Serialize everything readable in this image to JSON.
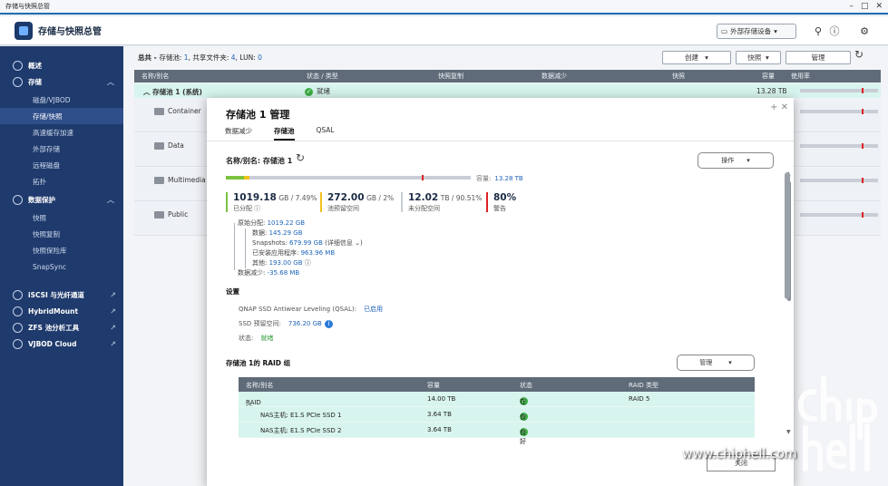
{
  "window": {
    "title": "存储与快照总管",
    "controls": [
      "–",
      "□",
      "✕"
    ]
  },
  "header": {
    "app_title": "存储与快照总管",
    "external_button": "外部存储设备"
  },
  "sidebar": {
    "items": [
      {
        "label": "概述",
        "level": "top"
      },
      {
        "label": "存储",
        "level": "top"
      },
      {
        "label": "磁盘/VJBOD",
        "level": "sub"
      },
      {
        "label": "存储/快照",
        "level": "sub",
        "active": true
      },
      {
        "label": "高速缓存加速",
        "level": "sub"
      },
      {
        "label": "外部存储",
        "level": "sub"
      },
      {
        "label": "远程磁盘",
        "level": "sub"
      },
      {
        "label": "拓扑",
        "level": "sub"
      },
      {
        "label": "数据保护",
        "level": "top"
      },
      {
        "label": "快照",
        "level": "sub"
      },
      {
        "label": "快照复制",
        "level": "sub"
      },
      {
        "label": "快照保险库",
        "level": "sub"
      },
      {
        "label": "SnapSync",
        "level": "sub"
      },
      {
        "label": "iSCSI 与光纤通道",
        "level": "top"
      },
      {
        "label": "HybridMount",
        "level": "top"
      },
      {
        "label": "ZFS 池分析工具",
        "level": "top"
      },
      {
        "label": "VJBOD Cloud",
        "level": "top"
      }
    ]
  },
  "main": {
    "summary_prefix": "总共 - ",
    "summary_pool_label": "存储池: ",
    "summary_pool_val": "1",
    "summary_share_label": ", 共享文件夹: ",
    "summary_share_val": "4",
    "summary_lun_label": ", LUN: ",
    "summary_lun_val": "0",
    "toolbar": {
      "create": "创建",
      "snapshot": "快照",
      "manage": "管理"
    },
    "columns": [
      "名称/别名",
      "状态 / 类型",
      "快照复制",
      "数据减少",
      "快照",
      "容量",
      "使用率"
    ],
    "pool_row": {
      "name": "存储池 1 (系统)",
      "status": "就绪",
      "capacity": "13.28 TB"
    },
    "folders": [
      "Container",
      "Data",
      "Multimedia",
      "Public"
    ]
  },
  "modal": {
    "title": "存储池 1 管理",
    "tabs": [
      "数据减少",
      "存储池",
      "QSAL"
    ],
    "pool_name": "名称/别名: 存储池 1",
    "action_button": "操作",
    "capacity_label": "容量:",
    "capacity_value": "13.28 TB",
    "stats": [
      {
        "num": "1019.18",
        "unit": "GB / 7.49%",
        "label": "已分配",
        "color": "#7cc33f"
      },
      {
        "num": "272.00",
        "unit": "GB / 2%",
        "label": "池预留空间",
        "color": "#f2c21c"
      },
      {
        "num": "12.02",
        "unit": "TB / 90.51%",
        "label": "未分配空间",
        "color": "#c9ced6"
      },
      {
        "num": "80%",
        "unit": "",
        "label": "警告",
        "color": "#d22"
      }
    ],
    "usage": {
      "allocated_pct": 7.49,
      "reserved_pct": 2,
      "warning_pct": 80
    },
    "tree": {
      "original_label": "原始分配:",
      "original_val": "1019.22 GB",
      "data_label": "数据:",
      "data_val": "145.29 GB",
      "snap_label": "Snapshots:",
      "snap_val": "679.99 GB",
      "snap_detail": "(详细信息 ⌄)",
      "apps_label": "已安装应用程序:",
      "apps_val": "963.96 MB",
      "other_label": "其他:",
      "other_val": "193.00 GB",
      "reduce_label": "数据减少:",
      "reduce_val": "-35.68 MB"
    },
    "settings": {
      "title": "设置",
      "qsal_label": "QNAP SSD Antiwear Leveling (QSAL):",
      "qsal_val": "已启用",
      "reserve_label": "SSD 预留空间:",
      "reserve_val": "736.20 GB",
      "status_label": "状态:",
      "status_val": "就绪"
    },
    "raid": {
      "title": "存储池 1的 RAID 组",
      "manage_button": "管理",
      "columns": [
        "名称/别名",
        "容量",
        "状态",
        "RAID 类型"
      ],
      "rows": [
        {
          "name": "RAID 组 1",
          "capacity": "14.00 TB",
          "status": "在线",
          "type": "RAID 5"
        },
        {
          "name": "NAS主机: E1.S PCIe SSD 1",
          "capacity": "3.64 TB",
          "status": "良好",
          "type": ""
        },
        {
          "name": "NAS主机: E1.S PCIe SSD 2",
          "capacity": "3.64 TB",
          "status": "良好",
          "type": ""
        }
      ]
    },
    "close_button": "关闭"
  },
  "watermark": {
    "text": "www.chiphell.com"
  }
}
